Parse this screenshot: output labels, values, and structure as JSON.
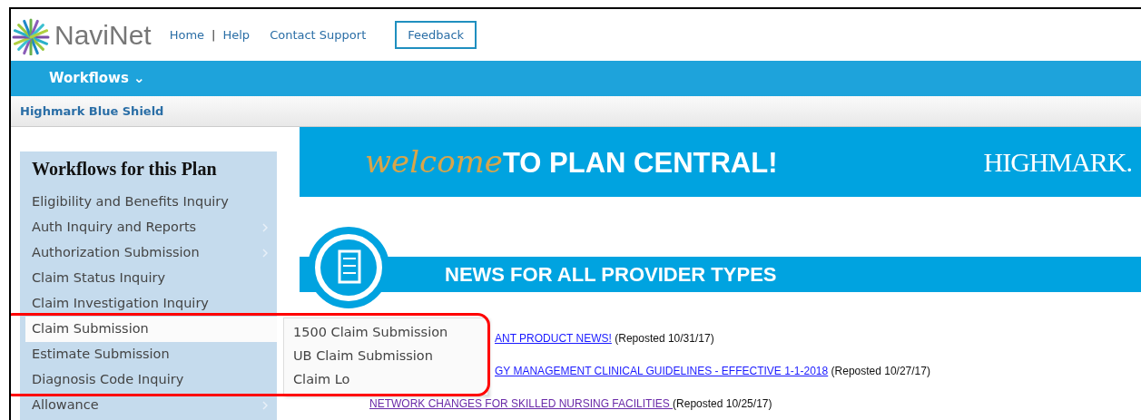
{
  "header": {
    "logo_text": "NaviNet",
    "links": [
      {
        "label": "Home",
        "kind": "link"
      },
      {
        "label": "|",
        "kind": "separator"
      },
      {
        "label": "Help",
        "kind": "link"
      },
      {
        "label": "Contact Support",
        "kind": "link"
      }
    ],
    "feedback_button": "Feedback"
  },
  "nav_bar": {
    "menu": "Workflows",
    "caret": "⌄"
  },
  "plan_bar": {
    "title": "Highmark Blue Shield"
  },
  "sidebar": {
    "title": "Workflows for this Plan",
    "items": [
      {
        "label": "Eligibility and Benefits Inquiry",
        "has_submenu": false,
        "selected": false
      },
      {
        "label": "Auth Inquiry and Reports",
        "has_submenu": true,
        "selected": false
      },
      {
        "label": "Authorization Submission",
        "has_submenu": true,
        "selected": false
      },
      {
        "label": "Claim Status Inquiry",
        "has_submenu": false,
        "selected": false
      },
      {
        "label": "Claim Investigation Inquiry",
        "has_submenu": false,
        "selected": false
      },
      {
        "label": "Claim Submission",
        "has_submenu": false,
        "selected": true
      },
      {
        "label": "Estimate Submission",
        "has_submenu": false,
        "selected": false
      },
      {
        "label": "Diagnosis Code Inquiry",
        "has_submenu": false,
        "selected": false
      },
      {
        "label": "Allowance",
        "has_submenu": true,
        "selected": false
      }
    ]
  },
  "submenu": {
    "items": [
      {
        "label": "1500 Claim Submission"
      },
      {
        "label": "UB Claim Submission"
      },
      {
        "label": "Claim Lo"
      }
    ]
  },
  "banner": {
    "script_word": "welcome",
    "headline": "TO PLAN CENTRAL!",
    "brand": "HIGHMARK."
  },
  "news": {
    "heading": "NEWS FOR ALL PROVIDER TYPES",
    "items": [
      {
        "link": "ANT PRODUCT NEWS!",
        "note": "(Reposted 10/31/17)",
        "visited": false
      },
      {
        "link": "GY MANAGEMENT CLINICAL GUIDELINES - EFFECTIVE 1-1-2018",
        "note": "(Reposted 10/27/17)",
        "visited": false
      },
      {
        "link": "NETWORK CHANGES FOR SKILLED NURSING FACILITIES ",
        "note": "(Reposted 10/25/17)",
        "visited": true
      }
    ]
  },
  "annotations": {
    "highlight": true
  }
}
